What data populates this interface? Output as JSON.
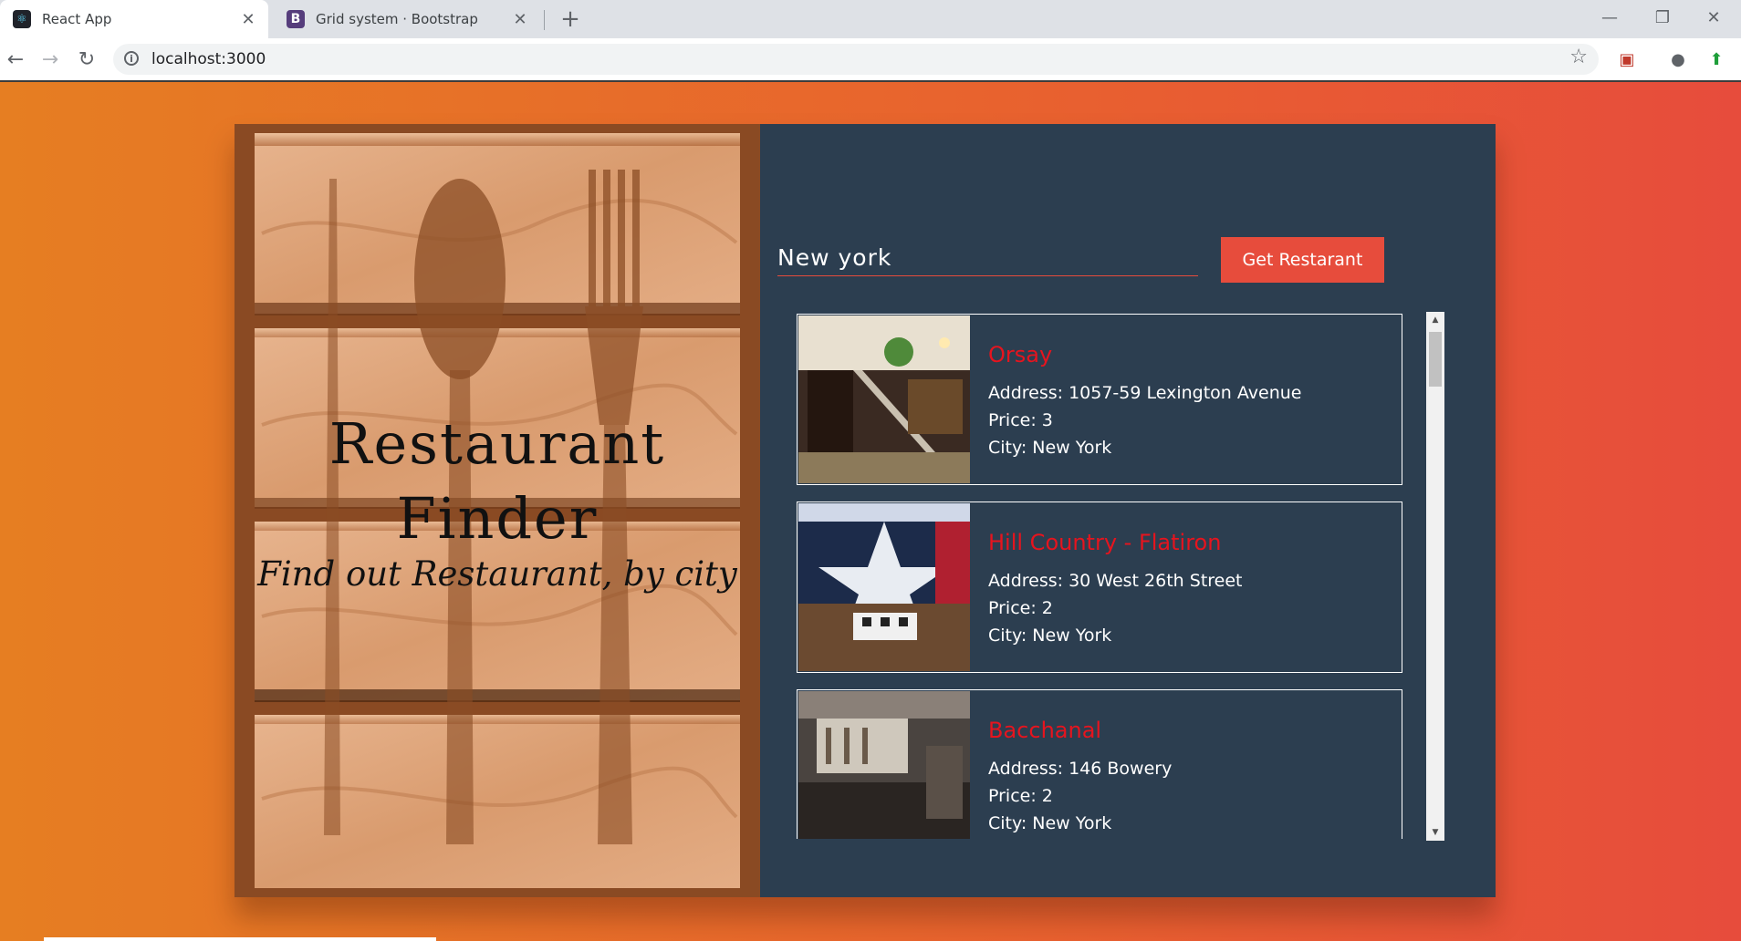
{
  "browser": {
    "tabs": [
      {
        "title": "React App",
        "icon": "react-icon"
      },
      {
        "title": "Grid system · Bootstrap",
        "icon": "bootstrap-icon"
      }
    ],
    "url": "localhost:3000"
  },
  "hero": {
    "title_line1": "Restaurant",
    "title_line2": "Finder",
    "subtitle": "Find out Restaurant, by city"
  },
  "search": {
    "value": "New york",
    "button_label": "Get Restarant"
  },
  "labels": {
    "address": "Address:",
    "price": "Price:",
    "city": "City:"
  },
  "restaurants": [
    {
      "name": "Orsay",
      "address": "1057-59 Lexington Avenue",
      "price": "3",
      "city": "New York"
    },
    {
      "name": "Hill Country - Flatiron",
      "address": "30 West 26th Street",
      "price": "2",
      "city": "New York"
    },
    {
      "name": "Bacchanal",
      "address": "146 Bowery",
      "price": "2",
      "city": "New York"
    }
  ],
  "colors": {
    "accent": "#e74c3c",
    "panel": "#2c3e50",
    "restaurant_name": "#e6141e"
  }
}
